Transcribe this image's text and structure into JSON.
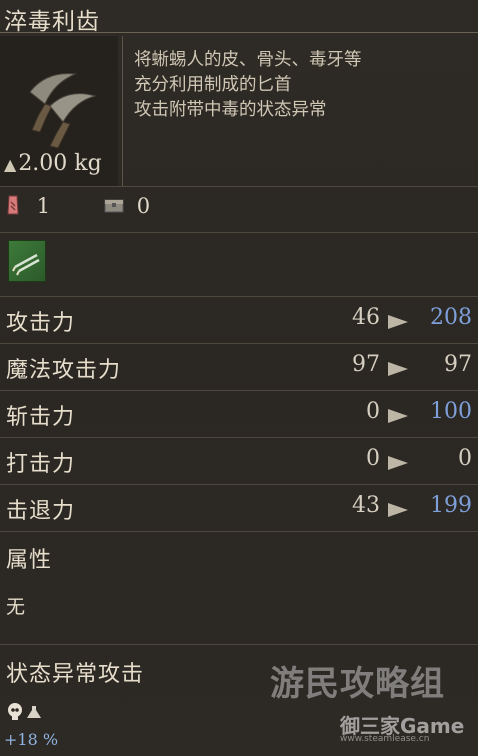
{
  "item": {
    "name": "淬毒利齿",
    "description": [
      "将蜥蜴人的皮、骨头、毒牙等",
      "充分利用制成的匕首",
      "攻击附带中毒的状态异常"
    ],
    "weight": "2.00 kg",
    "icon": "twin-daggers-icon"
  },
  "counts": {
    "owned": "1",
    "storage": "0",
    "owned_icon": "inventory-bag-icon",
    "storage_icon": "storage-chest-icon"
  },
  "badge_icon": "dagger-class-badge-icon",
  "stats": [
    {
      "label": "攻击力",
      "current": "46",
      "new": "208",
      "new_color": "#7e9fd9"
    },
    {
      "label": "魔法攻击力",
      "current": "97",
      "new": "97",
      "new_color": "#d6cfc1"
    },
    {
      "label": "斩击力",
      "current": "0",
      "new": "100",
      "new_color": "#7e9fd9"
    },
    {
      "label": "打击力",
      "current": "0",
      "new": "0",
      "new_color": "#d6cfc1"
    },
    {
      "label": "击退力",
      "current": "43",
      "new": "199",
      "new_color": "#7e9fd9"
    }
  ],
  "attribute": {
    "label": "属性",
    "value": "无"
  },
  "status_attack": {
    "label": "状态异常攻击",
    "icon": "poison-skull-icon",
    "value": "+18 %"
  },
  "watermark": {
    "line1": "游民攻略组",
    "line2": "御三家Game",
    "line3": "www.steamlease.cn"
  }
}
